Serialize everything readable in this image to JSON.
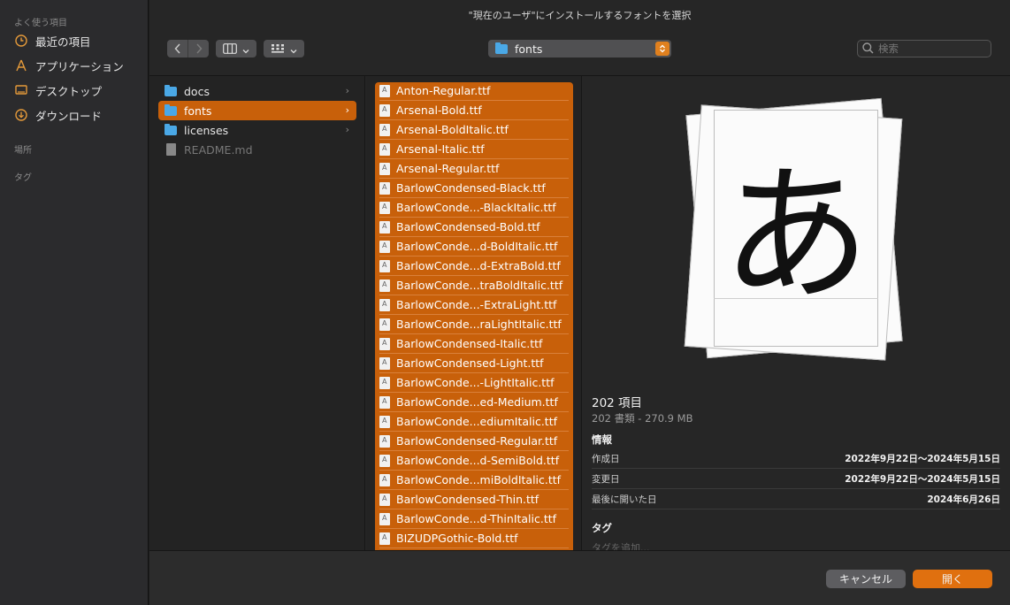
{
  "window": {
    "title": "\"現在のユーザ\"にインストールするフォントを選択"
  },
  "sidebar": {
    "favorites_label": "よく使う項目",
    "items": [
      {
        "label": "最近の項目",
        "icon": "clock-icon"
      },
      {
        "label": "アプリケーション",
        "icon": "applications-icon"
      },
      {
        "label": "デスクトップ",
        "icon": "desktop-icon"
      },
      {
        "label": "ダウンロード",
        "icon": "download-icon"
      }
    ],
    "locations_label": "場所",
    "tags_label": "タグ"
  },
  "toolbar": {
    "path_label": "fonts",
    "search_placeholder": "検索"
  },
  "column1": {
    "items": [
      {
        "label": "docs",
        "type": "folder"
      },
      {
        "label": "fonts",
        "type": "folder",
        "selected": true
      },
      {
        "label": "licenses",
        "type": "folder"
      },
      {
        "label": "README.md",
        "type": "file",
        "dimmed": true
      }
    ]
  },
  "column2": {
    "items": [
      "Anton-Regular.ttf",
      "Arsenal-Bold.ttf",
      "Arsenal-BoldItalic.ttf",
      "Arsenal-Italic.ttf",
      "Arsenal-Regular.ttf",
      "BarlowCondensed-Black.ttf",
      "BarlowConde...-BlackItalic.ttf",
      "BarlowCondensed-Bold.ttf",
      "BarlowConde...d-BoldItalic.ttf",
      "BarlowConde...d-ExtraBold.ttf",
      "BarlowConde...traBoldItalic.ttf",
      "BarlowConde...-ExtraLight.ttf",
      "BarlowConde...raLightItalic.ttf",
      "BarlowCondensed-Italic.ttf",
      "BarlowCondensed-Light.ttf",
      "BarlowConde...-LightItalic.ttf",
      "BarlowConde...ed-Medium.ttf",
      "BarlowConde...ediumItalic.ttf",
      "BarlowCondensed-Regular.ttf",
      "BarlowConde...d-SemiBold.ttf",
      "BarlowConde...miBoldItalic.ttf",
      "BarlowCondensed-Thin.ttf",
      "BarlowConde...d-ThinItalic.ttf",
      "BIZUDPGothic-Bold.ttf"
    ]
  },
  "preview": {
    "glyph": "あ",
    "count_title": "202 項目",
    "summary": "202 書類 - 270.9 MB",
    "info_heading": "情報",
    "rows": [
      {
        "key": "作成日",
        "value": "2022年9月22日〜2024年5月15日"
      },
      {
        "key": "変更日",
        "value": "2022年9月22日〜2024年5月15日"
      },
      {
        "key": "最後に開いた日",
        "value": "2024年6月26日"
      }
    ],
    "tags_heading": "タグ",
    "tags_placeholder": "タグを追加..."
  },
  "footer": {
    "cancel_label": "キャンセル",
    "open_label": "開く"
  },
  "colors": {
    "accent": "#c8600a",
    "button_primary": "#e0700f",
    "folder": "#4aa8e6"
  }
}
